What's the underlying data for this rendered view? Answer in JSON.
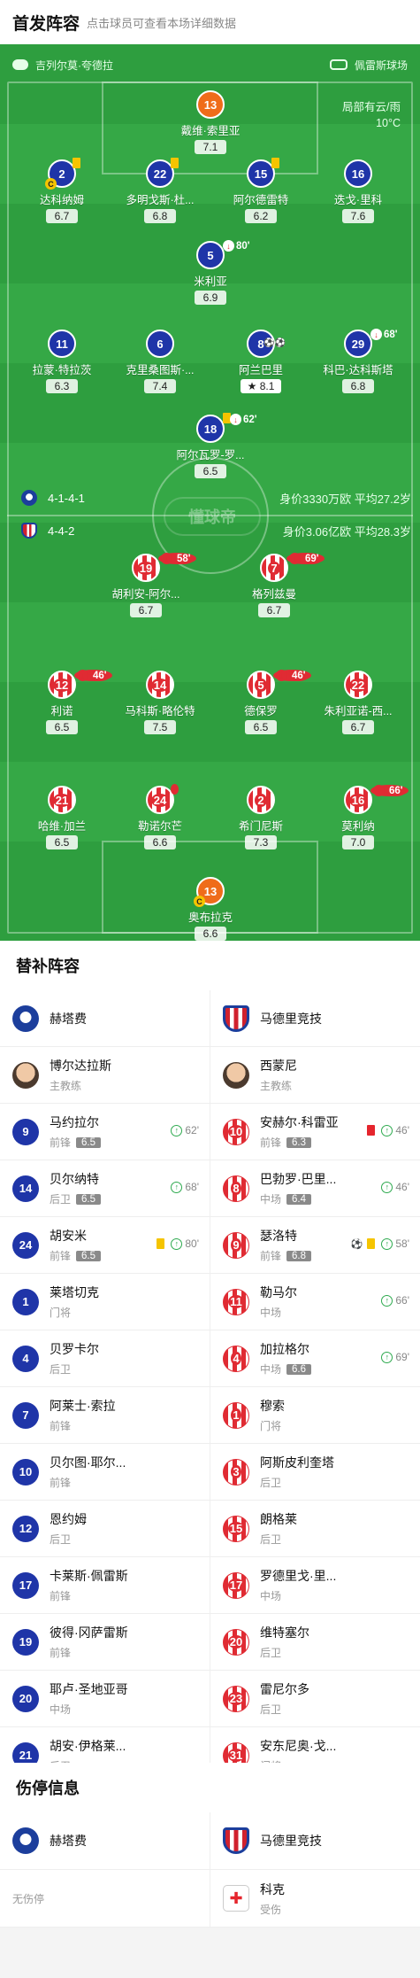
{
  "header": {
    "title": "首发阵容",
    "hint": "点击球员可查看本场详细数据"
  },
  "pitch": {
    "referee": "吉列尔莫·夸德拉",
    "stadium": "佩雷斯球场",
    "weather_line1": "局部有云/雨",
    "weather_line2": "10°C",
    "watermark": "懂球帝",
    "home_formation": "4-1-4-1",
    "home_stats": "身价3330万欧  平均27.2岁",
    "away_formation": "4-4-2",
    "away_stats": "身价3.06亿欧  平均28.3岁"
  },
  "home_players": [
    {
      "num": "13",
      "name": "戴维·索里亚",
      "rating": "7.1",
      "gk": true
    },
    {
      "num": "2",
      "name": "达科纳姆",
      "rating": "6.7",
      "captain": true,
      "yellow": true
    },
    {
      "num": "22",
      "name": "多明戈斯·杜...",
      "rating": "6.8",
      "yellow": true
    },
    {
      "num": "15",
      "name": "阿尔德雷特",
      "rating": "6.2",
      "yellow": true
    },
    {
      "num": "16",
      "name": "迭戈·里科",
      "rating": "7.6"
    },
    {
      "num": "5",
      "name": "米利亚",
      "rating": "6.9",
      "sub": "80'"
    },
    {
      "num": "11",
      "name": "拉蒙·特拉茨",
      "rating": "6.3"
    },
    {
      "num": "6",
      "name": "克里桑图斯·...",
      "rating": "7.4"
    },
    {
      "num": "8",
      "name": "阿兰巴里",
      "rating": "8.1",
      "star": true,
      "goals": "⚽⚽"
    },
    {
      "num": "29",
      "name": "科巴·达科斯塔",
      "rating": "6.8",
      "sub": "68'"
    },
    {
      "num": "18",
      "name": "阿尔瓦罗-罗...",
      "rating": "6.5",
      "sub": "62'",
      "yellow": true
    }
  ],
  "away_players": [
    {
      "num": "19",
      "name": "胡利安-阿尔...",
      "rating": "6.7",
      "sub": "58'"
    },
    {
      "num": "7",
      "name": "格列兹曼",
      "rating": "6.7",
      "sub": "69'"
    },
    {
      "num": "12",
      "name": "利诺",
      "rating": "6.5",
      "sub": "46'"
    },
    {
      "num": "14",
      "name": "马科斯·略伦特",
      "rating": "7.5"
    },
    {
      "num": "5",
      "name": "德保罗",
      "rating": "6.5",
      "sub": "46'"
    },
    {
      "num": "22",
      "name": "朱利亚诺-西...",
      "rating": "6.7"
    },
    {
      "num": "21",
      "name": "哈维·加兰",
      "rating": "6.5"
    },
    {
      "num": "24",
      "name": "勒诺尔芒",
      "rating": "6.6",
      "yellow": true
    },
    {
      "num": "2",
      "name": "希门尼斯",
      "rating": "7.3"
    },
    {
      "num": "16",
      "name": "莫利纳",
      "rating": "7.0",
      "sub": "66'"
    },
    {
      "num": "13",
      "name": "奥布拉克",
      "rating": "6.6",
      "gk": true,
      "captain": true
    }
  ],
  "subs_section": {
    "title": "替补阵容",
    "home_team": "赫塔费",
    "away_team": "马德里竞技",
    "home_coach": {
      "name": "博尔达拉斯",
      "role": "主教练"
    },
    "away_coach": {
      "name": "西蒙尼",
      "role": "主教练"
    },
    "rows": [
      {
        "h": {
          "num": "9",
          "name": "马约拉尔",
          "pos": "前锋",
          "rating": "6.5",
          "in": "62'"
        },
        "a": {
          "num": "10",
          "name": "安赫尔·科雷亚",
          "pos": "前锋",
          "rating": "6.3",
          "in": "46'",
          "red": true
        }
      },
      {
        "h": {
          "num": "14",
          "name": "贝尔纳特",
          "pos": "后卫",
          "rating": "6.5",
          "in": "68'"
        },
        "a": {
          "num": "8",
          "name": "巴勃罗·巴里...",
          "pos": "中场",
          "rating": "6.4",
          "in": "46'"
        }
      },
      {
        "h": {
          "num": "24",
          "name": "胡安米",
          "pos": "前锋",
          "rating": "6.5",
          "in": "80'",
          "yellow": true
        },
        "a": {
          "num": "9",
          "name": "瑟洛特",
          "pos": "前锋",
          "rating": "6.8",
          "in": "58'",
          "goal": true,
          "yellow": true
        }
      },
      {
        "h": {
          "num": "1",
          "name": "莱塔切克",
          "pos": "门将"
        },
        "a": {
          "num": "11",
          "name": "勒马尔",
          "pos": "中场",
          "in": "66'"
        }
      },
      {
        "h": {
          "num": "4",
          "name": "贝罗卡尔",
          "pos": "后卫"
        },
        "a": {
          "num": "4",
          "name": "加拉格尔",
          "pos": "中场",
          "rating": "6.6",
          "in": "69'"
        }
      },
      {
        "h": {
          "num": "7",
          "name": "阿莱士·索拉",
          "pos": "前锋"
        },
        "a": {
          "num": "1",
          "name": "穆索",
          "pos": "门将"
        }
      },
      {
        "h": {
          "num": "10",
          "name": "贝尔图·耶尔...",
          "pos": "前锋"
        },
        "a": {
          "num": "3",
          "name": "阿斯皮利奎塔",
          "pos": "后卫"
        }
      },
      {
        "h": {
          "num": "12",
          "name": "恩约姆",
          "pos": "后卫"
        },
        "a": {
          "num": "15",
          "name": "朗格莱",
          "pos": "后卫"
        }
      },
      {
        "h": {
          "num": "17",
          "name": "卡莱斯·佩雷斯",
          "pos": "前锋"
        },
        "a": {
          "num": "17",
          "name": "罗德里戈·里...",
          "pos": "中场"
        }
      },
      {
        "h": {
          "num": "19",
          "name": "彼得·冈萨雷斯",
          "pos": "前锋"
        },
        "a": {
          "num": "20",
          "name": "维特塞尔",
          "pos": "后卫"
        }
      },
      {
        "h": {
          "num": "20",
          "name": "耶卢·圣地亚哥",
          "pos": "中场"
        },
        "a": {
          "num": "23",
          "name": "雷尼尔多",
          "pos": "后卫"
        }
      },
      {
        "h": {
          "num": "21",
          "name": "胡安·伊格莱...",
          "pos": "后卫"
        },
        "a": {
          "num": "31",
          "name": "安东尼奥·戈...",
          "pos": "门将"
        }
      }
    ]
  },
  "injury_section": {
    "title": "伤停信息",
    "home_team": "赫塔费",
    "away_team": "马德里竞技",
    "home_none": "无伤停",
    "away_player": {
      "name": "科克",
      "status": "受伤"
    }
  }
}
